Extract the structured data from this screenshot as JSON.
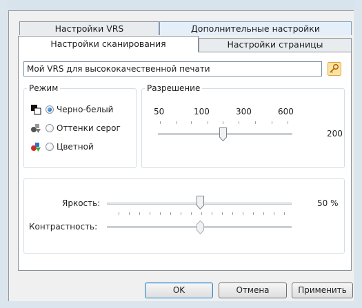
{
  "tabs": {
    "row_back": [
      "Настройки VRS",
      "Дополнительные настройки"
    ],
    "row_front": [
      "Настройки сканирования",
      "Настройки страницы"
    ]
  },
  "profile": {
    "name_value": "Мой VRS для высококачественной печати"
  },
  "mode": {
    "title": "Режим",
    "options": [
      {
        "label": "Черно-белый",
        "checked": true,
        "icon": "black-white-mode-icon"
      },
      {
        "label": "Оттенки серог",
        "checked": false,
        "icon": "grayscale-mode-icon"
      },
      {
        "label": "Цветной",
        "checked": false,
        "icon": "color-mode-icon"
      }
    ]
  },
  "resolution": {
    "title": "Разрешение",
    "scale_labels": [
      "50",
      "100",
      "300",
      "600"
    ],
    "value": "200"
  },
  "adjustments": {
    "brightness_label": "Яркость:",
    "brightness_value": "50 %",
    "contrast_label": "Контрастность:"
  },
  "buttons": {
    "ok": "OK",
    "cancel": "Отмена",
    "apply": "Применить"
  },
  "colors": {
    "window_frame": "#dbe5ee",
    "dialog_bg": "#f0f0f0",
    "accent": "#1a5fb4"
  }
}
